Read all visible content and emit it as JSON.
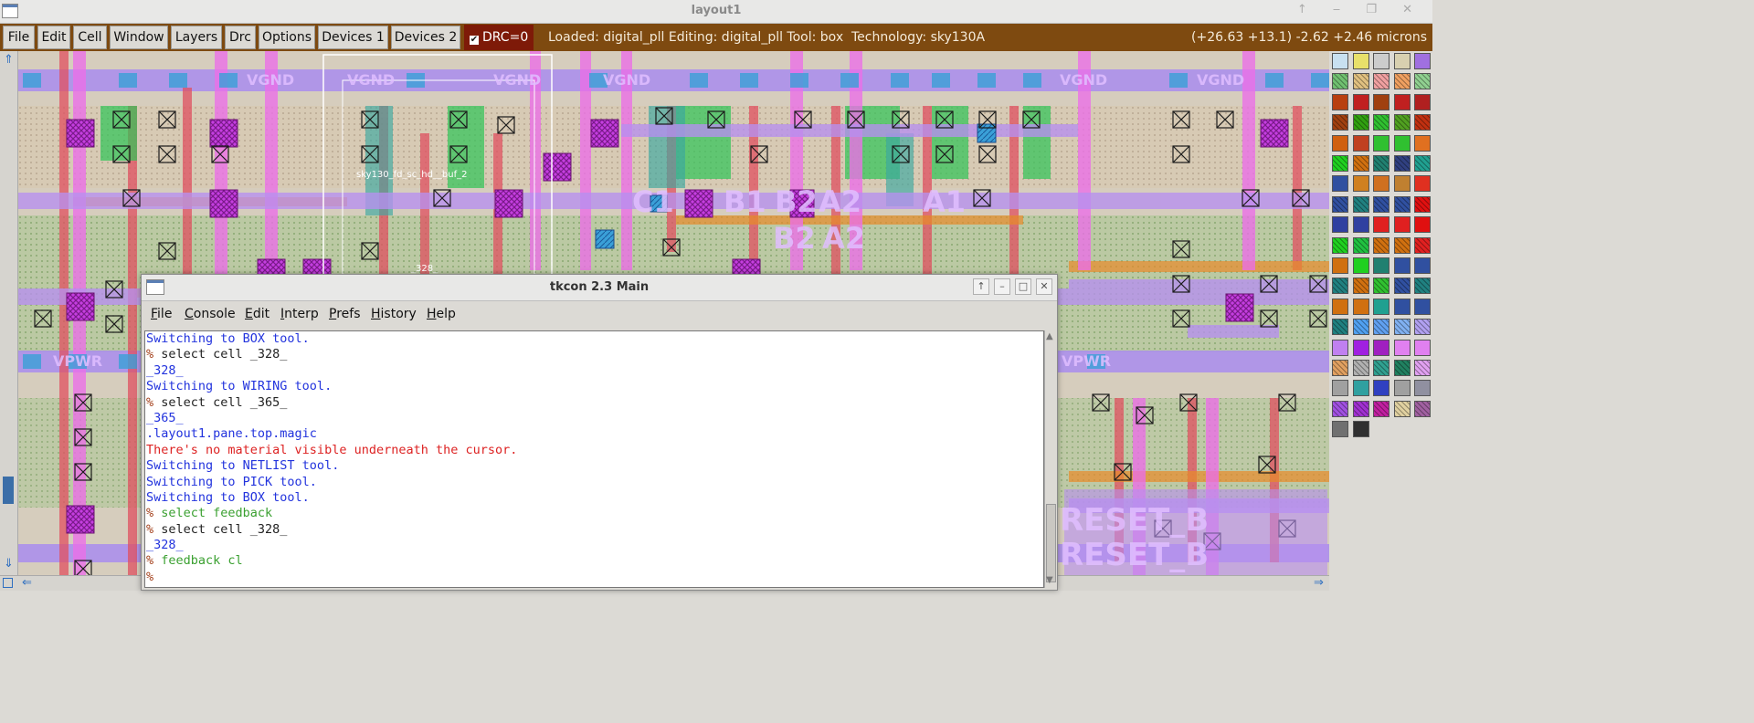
{
  "window": {
    "title": "layout1"
  },
  "menu": {
    "items": [
      "File",
      "Edit",
      "Cell",
      "Window",
      "Layers",
      "Drc",
      "Options",
      "Devices 1",
      "Devices 2"
    ],
    "drc_label": "DRC=0",
    "drc_checked": true
  },
  "status": {
    "text": "Loaded: digital_pll Editing: digital_pll Tool: box  Technology: sky130A",
    "coords": "(+26.63 +13.1) -2.62 +2.46 microns"
  },
  "layout": {
    "labels": [
      "VGND",
      "VGND",
      "VGND",
      "VGND",
      "VGND",
      "VGND",
      "VPWR",
      "VPWR",
      "C1",
      "B1",
      "B2",
      "A2",
      "A1",
      "B2",
      "A2",
      "RESET_B",
      "RESET_B",
      "sky130_fd_sc_hd__buf_2",
      "_328_"
    ]
  },
  "palette": {
    "colors": [
      "#c8e0f0",
      "#e8e06a",
      "#cccccc",
      "#d8d0b0",
      "#a070e0",
      "#70c070",
      "#e0c080",
      "#f0a0a0",
      "#f0a060",
      "#90d090",
      "#b84010",
      "#c02020",
      "#a04010",
      "#c02020",
      "#b02020",
      "#a04010",
      "#30a010",
      "#30c030",
      "#50a020",
      "#c03010",
      "#d06010",
      "#c04020",
      "#30c030",
      "#30c030",
      "#e07020",
      "#20d020",
      "#d07010",
      "#208070",
      "#304080",
      "#20a090",
      "#3050a0",
      "#d08020",
      "#d07020",
      "#c08030",
      "#e03020",
      "#3050a0",
      "#208080",
      "#3050a0",
      "#3050a0",
      "#e01010",
      "#3040a0",
      "#3040a0",
      "#e02020",
      "#e02020",
      "#e01010",
      "#20d020",
      "#20c040",
      "#d07010",
      "#d07010",
      "#e02020",
      "#d07010",
      "#20d020",
      "#208070",
      "#3050a0",
      "#3050a0",
      "#208080",
      "#d07010",
      "#30c030",
      "#3050a0",
      "#208080",
      "#d07010",
      "#d07010",
      "#20a090",
      "#3050a0",
      "#3050a0",
      "#208080",
      "#50a0f0",
      "#60a0f0",
      "#80b0f0",
      "#b0a0f0",
      "#c080f0",
      "#a020e0",
      "#a020c0",
      "#e080f0",
      "#e080f0",
      "#e0a060",
      "#b0b0b0",
      "#30a090",
      "#208060",
      "#e0a0f0",
      "#a0a0a0",
      "#30a0a0",
      "#3040c0",
      "#a0a0a0",
      "#9090a0",
      "#a050e0",
      "#a030d0",
      "#c020a0",
      "#e0d0a0",
      "#a060a0",
      "#707070",
      "#303030"
    ]
  },
  "tkcon": {
    "title": "tkcon 2.3 Main",
    "menu": [
      {
        "mnemonic": "F",
        "rest": "ile"
      },
      {
        "mnemonic": "C",
        "rest": "onsole"
      },
      {
        "mnemonic": "E",
        "rest": "dit"
      },
      {
        "mnemonic": "I",
        "rest": "nterp"
      },
      {
        "mnemonic": "P",
        "rest": "refs"
      },
      {
        "mnemonic": "H",
        "rest": "istory"
      },
      {
        "mnemonic": "H",
        "rest": "elp"
      }
    ],
    "lines": [
      {
        "prompt": "",
        "text": "Switching to BOX tool.",
        "color": "blue"
      },
      {
        "prompt": "% ",
        "text": "select cell _328_",
        "color": "black"
      },
      {
        "prompt": "",
        "text": "_328_",
        "color": "blue"
      },
      {
        "prompt": "",
        "text": "Switching to WIRING tool.",
        "color": "blue"
      },
      {
        "prompt": "% ",
        "text": "select cell _365_",
        "color": "black"
      },
      {
        "prompt": "",
        "text": "_365_",
        "color": "blue"
      },
      {
        "prompt": "",
        "text": ".layout1.pane.top.magic",
        "color": "blue"
      },
      {
        "prompt": "",
        "text": "There's no material visible underneath the cursor.",
        "color": "red"
      },
      {
        "prompt": "",
        "text": "Switching to NETLIST tool.",
        "color": "blue"
      },
      {
        "prompt": "",
        "text": "Switching to PICK tool.",
        "color": "blue"
      },
      {
        "prompt": "",
        "text": "Switching to BOX tool.",
        "color": "blue"
      },
      {
        "prompt": "% ",
        "text": "select feedback",
        "color": "green"
      },
      {
        "prompt": "% ",
        "text": "select cell _328_",
        "color": "black"
      },
      {
        "prompt": "",
        "text": "_328_",
        "color": "blue"
      },
      {
        "prompt": "% ",
        "text": "feedback cl",
        "color": "green"
      },
      {
        "prompt": "%",
        "text": "",
        "color": "black"
      }
    ]
  }
}
